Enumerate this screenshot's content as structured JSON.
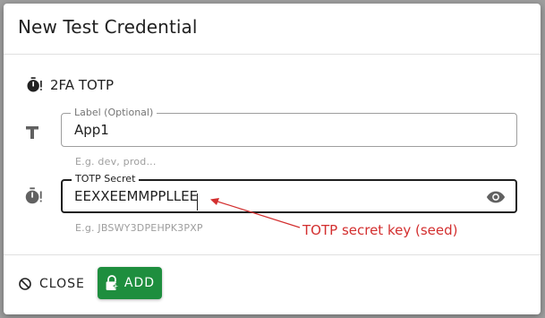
{
  "dialog": {
    "title": "New Test Credential"
  },
  "credential_type": {
    "label": "2FA TOTP",
    "icon": "stopwatch-alert-icon"
  },
  "label_field": {
    "legend": "Label (Optional)",
    "value": "App1",
    "hint": "E.g. dev, prod...",
    "icon": "text-t-icon"
  },
  "secret_field": {
    "legend": "TOTP Secret",
    "value": "EEXXEEMMPPLLEE",
    "hint": "E.g. JBSWY3DPEHPK3PXP",
    "icon": "stopwatch-alert-icon",
    "visibility_icon": "eye-icon"
  },
  "annotation": {
    "text": "TOTP secret key (seed)",
    "color": "#d32f2f"
  },
  "actions": {
    "close_label": "CLOSE",
    "add_label": "ADD",
    "add_color": "#1e8e3e"
  }
}
